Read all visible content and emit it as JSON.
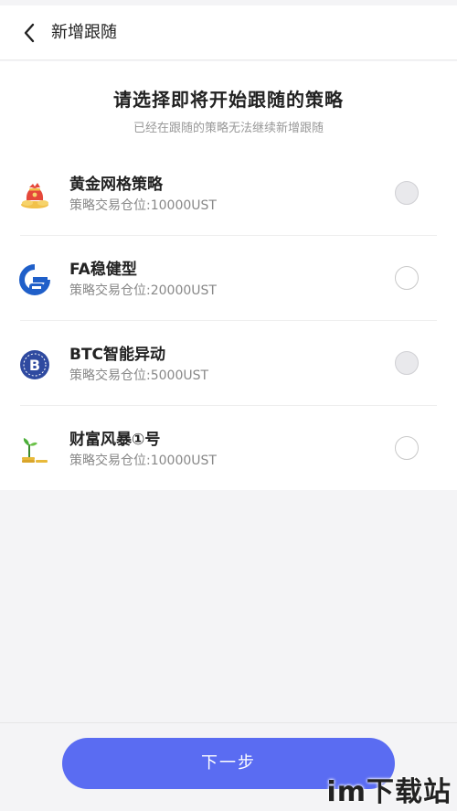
{
  "header": {
    "back_icon": "chevron-left-icon",
    "title": "新增跟随"
  },
  "intro": {
    "title": "请选择即将开始跟随的策略",
    "subtitle": "已经在跟随的策略无法继续新增跟随"
  },
  "strategies": [
    {
      "name": "黄金网格策略",
      "desc": "策略交易仓位:10000UST",
      "icon": "gold-pouch-icon",
      "selectable": false
    },
    {
      "name": "FA稳健型",
      "desc": "策略交易仓位:20000UST",
      "icon": "fa-logo-icon",
      "selectable": true
    },
    {
      "name": "BTC智能异动",
      "desc": "策略交易仓位:5000UST",
      "icon": "bitcoin-icon",
      "selectable": false
    },
    {
      "name": "财富风暴①号",
      "desc": "策略交易仓位:10000UST",
      "icon": "sprout-coins-icon",
      "selectable": true
    }
  ],
  "footer": {
    "next_label": "下一步"
  },
  "watermark": "im下载站",
  "colors": {
    "primary": "#5a6cf2",
    "background": "#f4f4f6"
  }
}
